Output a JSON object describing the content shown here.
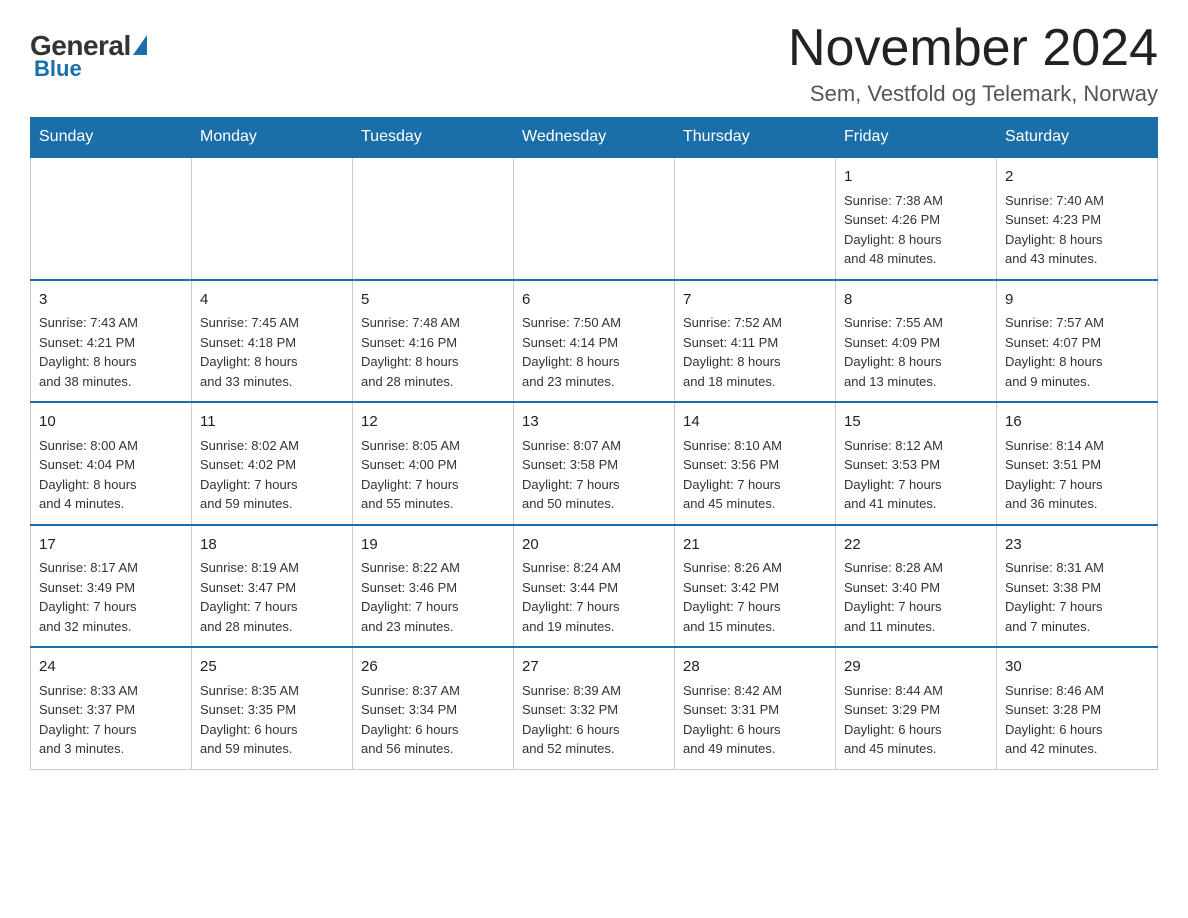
{
  "logo": {
    "general": "General",
    "blue": "Blue",
    "underline": "Blue"
  },
  "title": "November 2024",
  "location": "Sem, Vestfold og Telemark, Norway",
  "days_header": [
    "Sunday",
    "Monday",
    "Tuesday",
    "Wednesday",
    "Thursday",
    "Friday",
    "Saturday"
  ],
  "weeks": [
    [
      {
        "day": "",
        "info": ""
      },
      {
        "day": "",
        "info": ""
      },
      {
        "day": "",
        "info": ""
      },
      {
        "day": "",
        "info": ""
      },
      {
        "day": "",
        "info": ""
      },
      {
        "day": "1",
        "info": "Sunrise: 7:38 AM\nSunset: 4:26 PM\nDaylight: 8 hours\nand 48 minutes."
      },
      {
        "day": "2",
        "info": "Sunrise: 7:40 AM\nSunset: 4:23 PM\nDaylight: 8 hours\nand 43 minutes."
      }
    ],
    [
      {
        "day": "3",
        "info": "Sunrise: 7:43 AM\nSunset: 4:21 PM\nDaylight: 8 hours\nand 38 minutes."
      },
      {
        "day": "4",
        "info": "Sunrise: 7:45 AM\nSunset: 4:18 PM\nDaylight: 8 hours\nand 33 minutes."
      },
      {
        "day": "5",
        "info": "Sunrise: 7:48 AM\nSunset: 4:16 PM\nDaylight: 8 hours\nand 28 minutes."
      },
      {
        "day": "6",
        "info": "Sunrise: 7:50 AM\nSunset: 4:14 PM\nDaylight: 8 hours\nand 23 minutes."
      },
      {
        "day": "7",
        "info": "Sunrise: 7:52 AM\nSunset: 4:11 PM\nDaylight: 8 hours\nand 18 minutes."
      },
      {
        "day": "8",
        "info": "Sunrise: 7:55 AM\nSunset: 4:09 PM\nDaylight: 8 hours\nand 13 minutes."
      },
      {
        "day": "9",
        "info": "Sunrise: 7:57 AM\nSunset: 4:07 PM\nDaylight: 8 hours\nand 9 minutes."
      }
    ],
    [
      {
        "day": "10",
        "info": "Sunrise: 8:00 AM\nSunset: 4:04 PM\nDaylight: 8 hours\nand 4 minutes."
      },
      {
        "day": "11",
        "info": "Sunrise: 8:02 AM\nSunset: 4:02 PM\nDaylight: 7 hours\nand 59 minutes."
      },
      {
        "day": "12",
        "info": "Sunrise: 8:05 AM\nSunset: 4:00 PM\nDaylight: 7 hours\nand 55 minutes."
      },
      {
        "day": "13",
        "info": "Sunrise: 8:07 AM\nSunset: 3:58 PM\nDaylight: 7 hours\nand 50 minutes."
      },
      {
        "day": "14",
        "info": "Sunrise: 8:10 AM\nSunset: 3:56 PM\nDaylight: 7 hours\nand 45 minutes."
      },
      {
        "day": "15",
        "info": "Sunrise: 8:12 AM\nSunset: 3:53 PM\nDaylight: 7 hours\nand 41 minutes."
      },
      {
        "day": "16",
        "info": "Sunrise: 8:14 AM\nSunset: 3:51 PM\nDaylight: 7 hours\nand 36 minutes."
      }
    ],
    [
      {
        "day": "17",
        "info": "Sunrise: 8:17 AM\nSunset: 3:49 PM\nDaylight: 7 hours\nand 32 minutes."
      },
      {
        "day": "18",
        "info": "Sunrise: 8:19 AM\nSunset: 3:47 PM\nDaylight: 7 hours\nand 28 minutes."
      },
      {
        "day": "19",
        "info": "Sunrise: 8:22 AM\nSunset: 3:46 PM\nDaylight: 7 hours\nand 23 minutes."
      },
      {
        "day": "20",
        "info": "Sunrise: 8:24 AM\nSunset: 3:44 PM\nDaylight: 7 hours\nand 19 minutes."
      },
      {
        "day": "21",
        "info": "Sunrise: 8:26 AM\nSunset: 3:42 PM\nDaylight: 7 hours\nand 15 minutes."
      },
      {
        "day": "22",
        "info": "Sunrise: 8:28 AM\nSunset: 3:40 PM\nDaylight: 7 hours\nand 11 minutes."
      },
      {
        "day": "23",
        "info": "Sunrise: 8:31 AM\nSunset: 3:38 PM\nDaylight: 7 hours\nand 7 minutes."
      }
    ],
    [
      {
        "day": "24",
        "info": "Sunrise: 8:33 AM\nSunset: 3:37 PM\nDaylight: 7 hours\nand 3 minutes."
      },
      {
        "day": "25",
        "info": "Sunrise: 8:35 AM\nSunset: 3:35 PM\nDaylight: 6 hours\nand 59 minutes."
      },
      {
        "day": "26",
        "info": "Sunrise: 8:37 AM\nSunset: 3:34 PM\nDaylight: 6 hours\nand 56 minutes."
      },
      {
        "day": "27",
        "info": "Sunrise: 8:39 AM\nSunset: 3:32 PM\nDaylight: 6 hours\nand 52 minutes."
      },
      {
        "day": "28",
        "info": "Sunrise: 8:42 AM\nSunset: 3:31 PM\nDaylight: 6 hours\nand 49 minutes."
      },
      {
        "day": "29",
        "info": "Sunrise: 8:44 AM\nSunset: 3:29 PM\nDaylight: 6 hours\nand 45 minutes."
      },
      {
        "day": "30",
        "info": "Sunrise: 8:46 AM\nSunset: 3:28 PM\nDaylight: 6 hours\nand 42 minutes."
      }
    ]
  ]
}
